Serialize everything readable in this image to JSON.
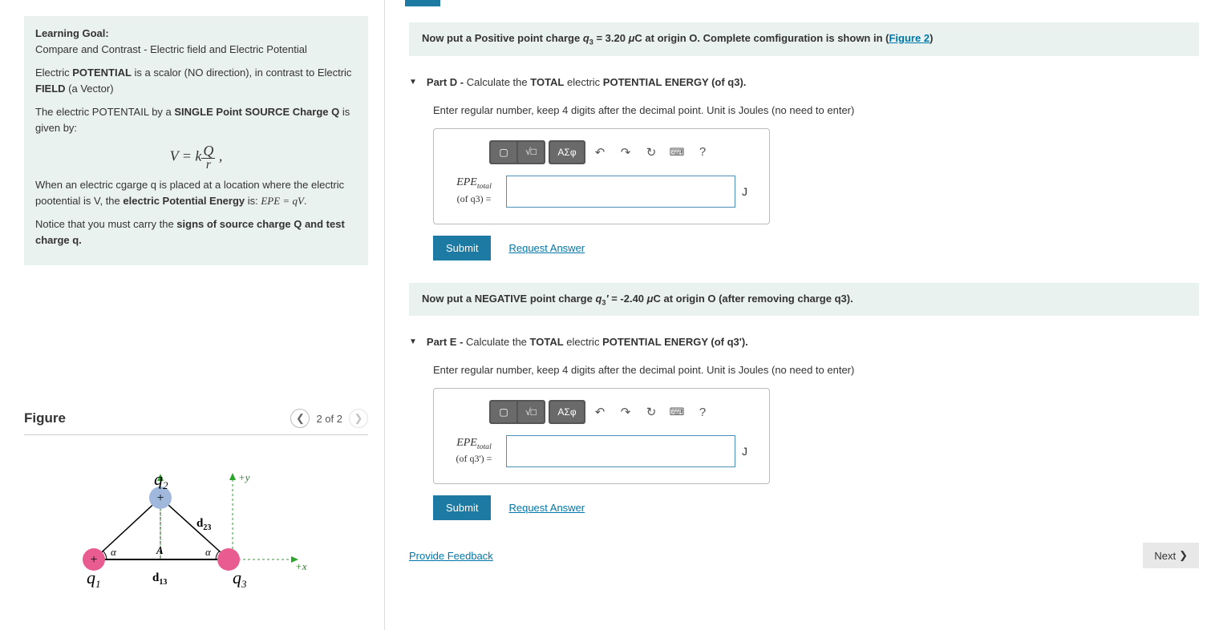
{
  "left": {
    "lg_title": "Learning Goal:",
    "lg_line1": "Compare and Contrast - Electric field and Electric Potential",
    "p2_a": "Electric ",
    "p2_b": "POTENTIAL",
    "p2_c": " is a scalor (NO direction), in contrast to Electric ",
    "p2_d": "FIELD",
    "p2_e": " (a Vector)",
    "p3_a": "The electric POTENTAIL by a ",
    "p3_b": "SINGLE Point SOURCE Charge Q",
    "p3_c": " is given by:",
    "formula1": "V = k Q / r ,",
    "p4_a": "When an electric cgarge q is placed at a location where the electric pootential is V, the ",
    "p4_b": "electric Potential Energy",
    "p4_c": " is:  ",
    "p4_formula": "EPE = qV",
    "p4_d": ".",
    "p5_a": "Notice that you must carry the ",
    "p5_b": "signs of source charge Q and test charge q.",
    "figure_title": "Figure",
    "page_info": "2 of 2"
  },
  "info1": {
    "a": "Now put a Positive point charge ",
    "q": "q",
    "sub": "3",
    "b": " = 3.20 ",
    "mu": "μ",
    "c": "C",
    "d": " at origin O. Complete comfiguration is shown in (",
    "link": "Figure 2",
    "e": ")"
  },
  "partD": {
    "label": "Part D - ",
    "t1": "Calculate the ",
    "t2": "TOTAL",
    "t3": " electric ",
    "t4": "POTENTIAL ENERGY (of q3).",
    "instr": "Enter regular number, keep 4 digits after the decimal point. Unit is Joules (no need to enter)",
    "math_var": "EPE",
    "math_sub": "total",
    "math_of": "(of q3) =",
    "unit": "J"
  },
  "info2": {
    "a": "Now put a NEGATIVE point charge ",
    "q": "q",
    "sub": "3",
    "prime": "′",
    "b": " = -2.40 ",
    "mu": "μ",
    "c": "C",
    "d": "  at origin O (after removing charge q3)."
  },
  "partE": {
    "label": "Part E - ",
    "t1": "Calculate the ",
    "t2": "TOTAL",
    "t3": " electric ",
    "t4": "POTENTIAL ENERGY (of q3').",
    "instr": "Enter regular number, keep 4 digits after the decimal point. Unit is Joules (no need to enter)",
    "math_var": "EPE",
    "math_sub": "total",
    "math_of": "(of q3') =",
    "unit": "J"
  },
  "buttons": {
    "submit": "Submit",
    "request": "Request Answer",
    "feedback": "Provide Feedback",
    "next": "Next",
    "greek": "ΑΣφ"
  },
  "svg": {
    "q1": "q",
    "q1s": "1",
    "q2": "q",
    "q2s": "2",
    "q3": "q",
    "q3s": "3",
    "d13": "d",
    "d13s": "13",
    "d23": "d",
    "d23s": "23",
    "A": "A",
    "alpha": "α",
    "py": "+y",
    "px": "+x"
  }
}
